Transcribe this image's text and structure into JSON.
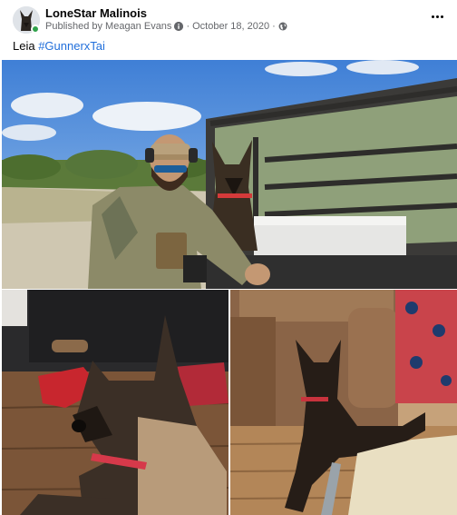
{
  "post": {
    "page_name": "LoneStar Malinois",
    "published_by": "Published by Meagan Evans",
    "separator": "·",
    "date": "October 18, 2020",
    "caption_text": "Leia",
    "hashtag": "#GunnerxTai"
  },
  "icons": {
    "avatar": "dog-avatar-icon",
    "info": "info-icon",
    "audience": "globe-icon",
    "more": "more-options-icon"
  },
  "colors": {
    "hashtag": "#216fdb",
    "meta_text": "#65676b",
    "online": "#31a24c"
  }
}
